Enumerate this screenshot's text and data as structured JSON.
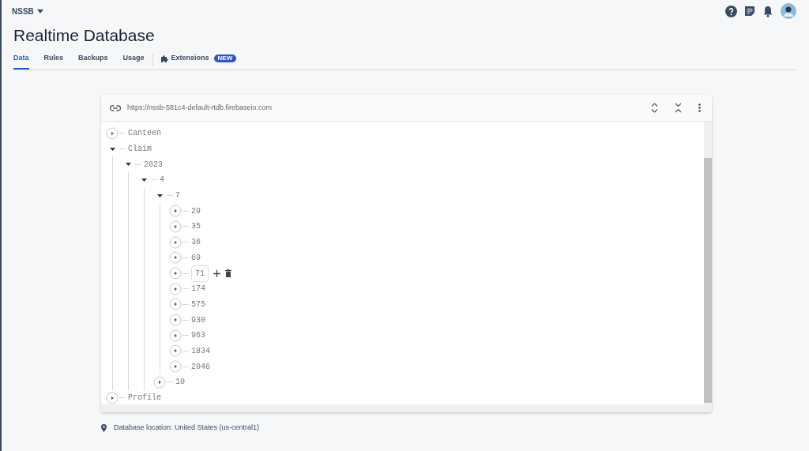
{
  "project": {
    "name": "NSSB"
  },
  "page_title": "Realtime Database",
  "tabs": [
    {
      "label": "Data",
      "selected": true
    },
    {
      "label": "Rules",
      "selected": false
    },
    {
      "label": "Backups",
      "selected": false
    },
    {
      "label": "Usage",
      "selected": false
    },
    {
      "label": "Extensions",
      "selected": false,
      "badge": "NEW"
    }
  ],
  "database": {
    "url": "https://nssb-581c4-default-rtdb.firebaseio.com",
    "tree": [
      {
        "key": "Canteen",
        "expanded": false,
        "selected": false
      },
      {
        "key": "Claim",
        "expanded": true,
        "selected": false,
        "children": [
          {
            "key": "2023",
            "expanded": true,
            "selected": false,
            "children": [
              {
                "key": "4",
                "expanded": true,
                "selected": false,
                "children": [
                  {
                    "key": "7",
                    "expanded": true,
                    "selected": false,
                    "children": [
                      {
                        "key": "29",
                        "expanded": false,
                        "selected": false
                      },
                      {
                        "key": "35",
                        "expanded": false,
                        "selected": false
                      },
                      {
                        "key": "36",
                        "expanded": false,
                        "selected": false
                      },
                      {
                        "key": "69",
                        "expanded": false,
                        "selected": false
                      },
                      {
                        "key": "71",
                        "expanded": false,
                        "selected": true
                      },
                      {
                        "key": "174",
                        "expanded": false,
                        "selected": false
                      },
                      {
                        "key": "575",
                        "expanded": false,
                        "selected": false
                      },
                      {
                        "key": "930",
                        "expanded": false,
                        "selected": false
                      },
                      {
                        "key": "963",
                        "expanded": false,
                        "selected": false
                      },
                      {
                        "key": "1834",
                        "expanded": false,
                        "selected": false
                      },
                      {
                        "key": "2046",
                        "expanded": false,
                        "selected": false
                      }
                    ]
                  },
                  {
                    "key": "10",
                    "expanded": false,
                    "selected": false
                  }
                ]
              }
            ]
          }
        ]
      },
      {
        "key": "Profile",
        "expanded": false,
        "selected": false
      }
    ]
  },
  "location": "Database location: United States (us-central1)"
}
